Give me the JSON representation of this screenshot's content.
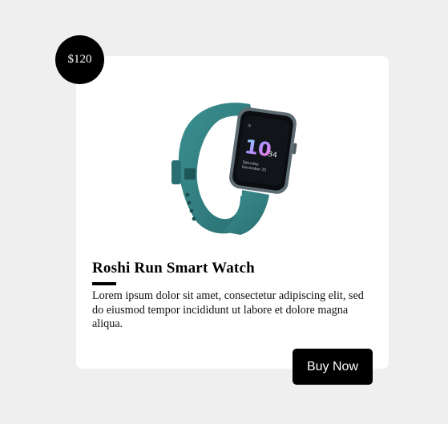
{
  "product": {
    "price": "$120",
    "title": "Roshi Run Smart Watch",
    "description": "Lorem ipsum dolor sit amet, consectetur adipiscing elit, sed do eiusmod tempor incididunt ut labore et dolore magna aliqua.",
    "buy_label": "Buy Now",
    "watch_screen": {
      "hour": "10",
      "minute": "34",
      "day": "Saturday",
      "date": "December 25"
    }
  },
  "colors": {
    "background": "#efefef",
    "card": "#ffffff",
    "accent": "#000000",
    "watch_band": "#2f7f80"
  },
  "icons": {
    "product_image": "smart-watch-icon"
  }
}
